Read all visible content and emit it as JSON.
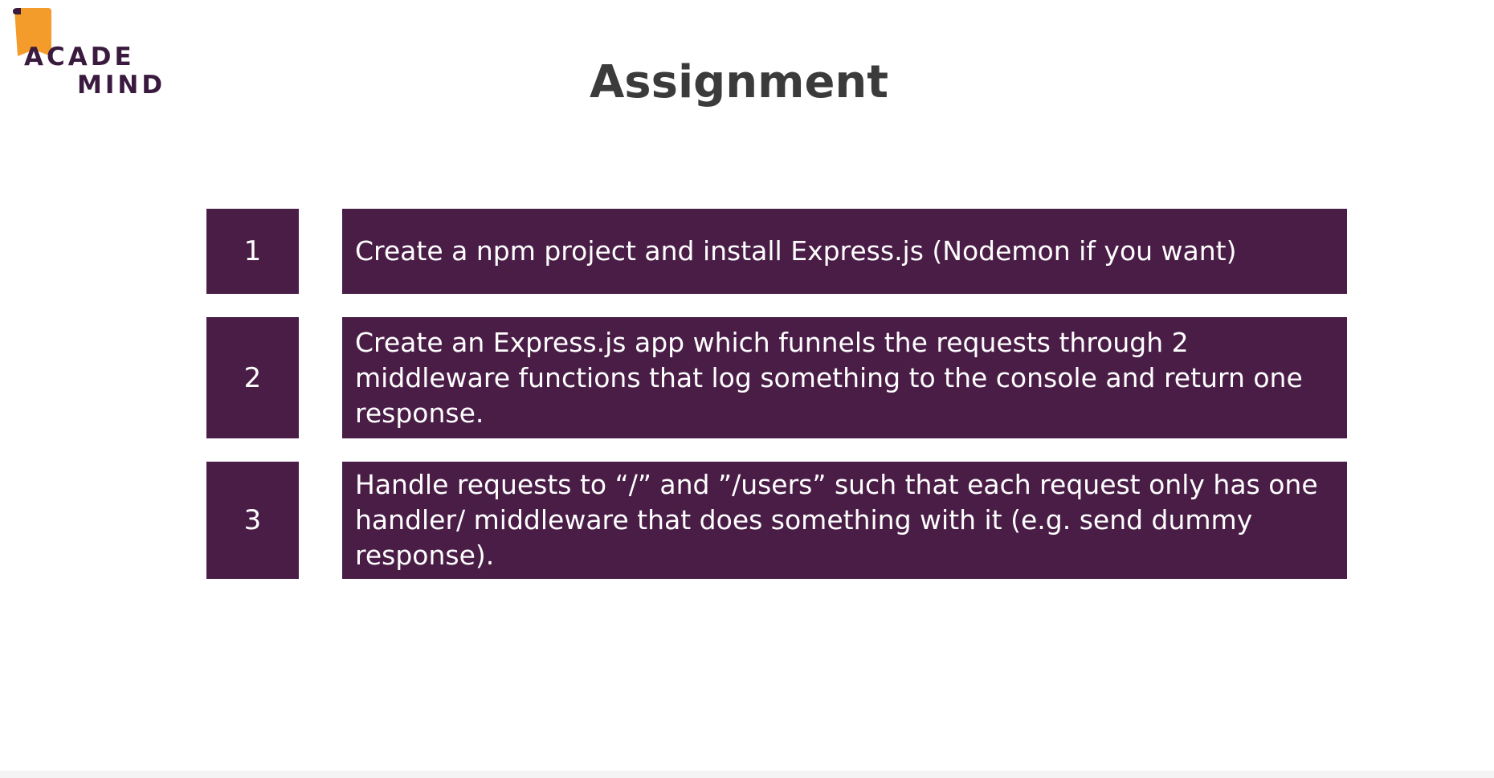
{
  "logo": {
    "line1": "ACADE",
    "line2": "MIND",
    "flag_color": "#f39c2b",
    "text_color": "#3a1a3e"
  },
  "slide": {
    "title": "Assignment"
  },
  "tasks": [
    {
      "number": "1",
      "text": "Create a npm project and install Express.js (Nodemon if you want)"
    },
    {
      "number": "2",
      "text": "Create an Express.js app which funnels the requests through 2 middleware functions that log something to the console and return one response."
    },
    {
      "number": "3",
      "text": "Handle requests to “/” and ”/users” such that each request only has one handler/ middleware that does something with it (e.g. send dummy response)."
    }
  ],
  "colors": {
    "box_background": "#4a1d47",
    "box_text": "#ffffff",
    "title_text": "#3b3b3b"
  }
}
